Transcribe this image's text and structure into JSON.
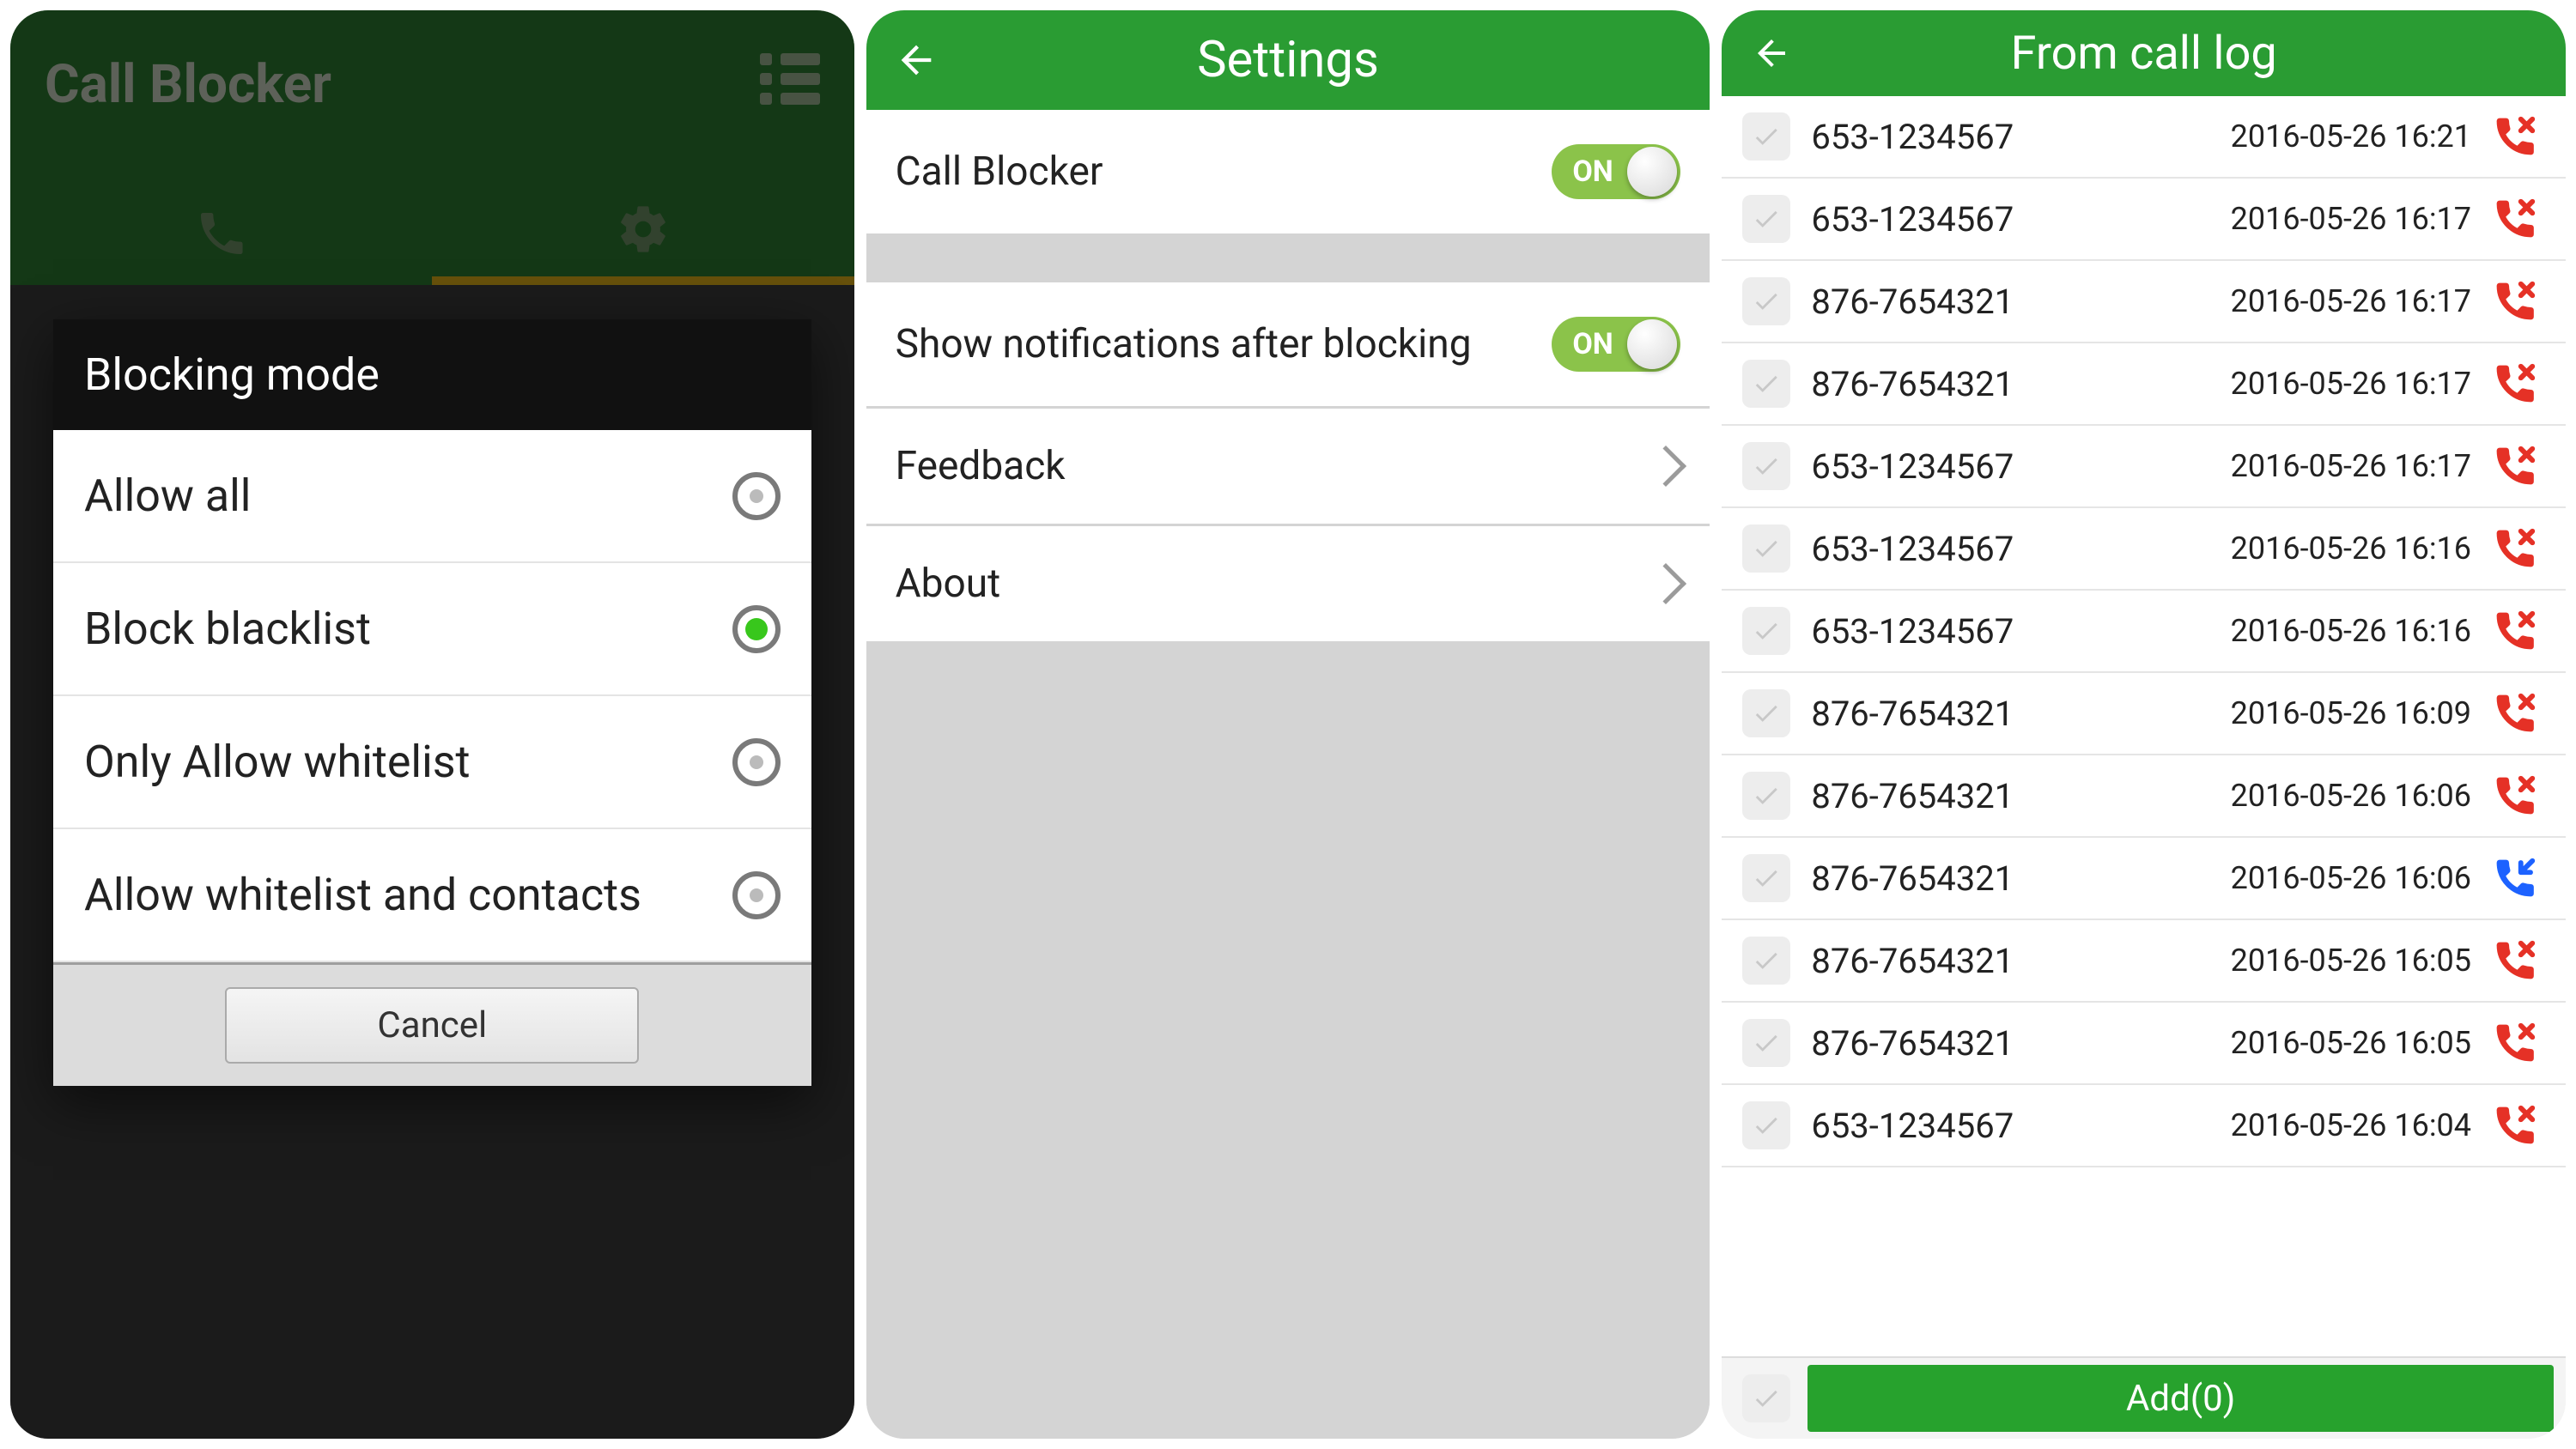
{
  "colors": {
    "brand_green": "#2a9c33",
    "accent_green": "#8bc34a",
    "toggle_on_text": "ON"
  },
  "panel1": {
    "app_title": "Call Blocker",
    "icons": {
      "menu": "list-menu-icon",
      "tab_phone": "phone-icon",
      "tab_settings": "gear-icon"
    },
    "dialog": {
      "title": "Blocking mode",
      "options": [
        {
          "label": "Allow all",
          "selected": false
        },
        {
          "label": "Block blacklist",
          "selected": true
        },
        {
          "label": "Only Allow whitelist",
          "selected": false
        },
        {
          "label": "Allow whitelist and contacts",
          "selected": false
        }
      ],
      "cancel_label": "Cancel"
    }
  },
  "panel2": {
    "title": "Settings",
    "rows": {
      "call_blocker": {
        "label": "Call Blocker",
        "toggle_on": true,
        "toggle_text": "ON"
      },
      "show_notif": {
        "label": "Show notifications after blocking",
        "toggle_on": true,
        "toggle_text": "ON"
      },
      "feedback": {
        "label": "Feedback"
      },
      "about": {
        "label": "About"
      }
    }
  },
  "panel3": {
    "title": "From call log",
    "entries": [
      {
        "number": "653-1234567",
        "time": "2016-05-26 16:21",
        "type": "missed"
      },
      {
        "number": "653-1234567",
        "time": "2016-05-26 16:17",
        "type": "missed"
      },
      {
        "number": "876-7654321",
        "time": "2016-05-26 16:17",
        "type": "missed"
      },
      {
        "number": "876-7654321",
        "time": "2016-05-26 16:17",
        "type": "missed"
      },
      {
        "number": "653-1234567",
        "time": "2016-05-26 16:17",
        "type": "missed"
      },
      {
        "number": "653-1234567",
        "time": "2016-05-26 16:16",
        "type": "missed"
      },
      {
        "number": "653-1234567",
        "time": "2016-05-26 16:16",
        "type": "missed"
      },
      {
        "number": "876-7654321",
        "time": "2016-05-26 16:09",
        "type": "missed"
      },
      {
        "number": "876-7654321",
        "time": "2016-05-26 16:06",
        "type": "missed"
      },
      {
        "number": "876-7654321",
        "time": "2016-05-26 16:06",
        "type": "incoming"
      },
      {
        "number": "876-7654321",
        "time": "2016-05-26 16:05",
        "type": "missed"
      },
      {
        "number": "876-7654321",
        "time": "2016-05-26 16:05",
        "type": "missed"
      },
      {
        "number": "653-1234567",
        "time": "2016-05-26 16:04",
        "type": "missed"
      }
    ],
    "add_button_label": "Add(0)"
  }
}
